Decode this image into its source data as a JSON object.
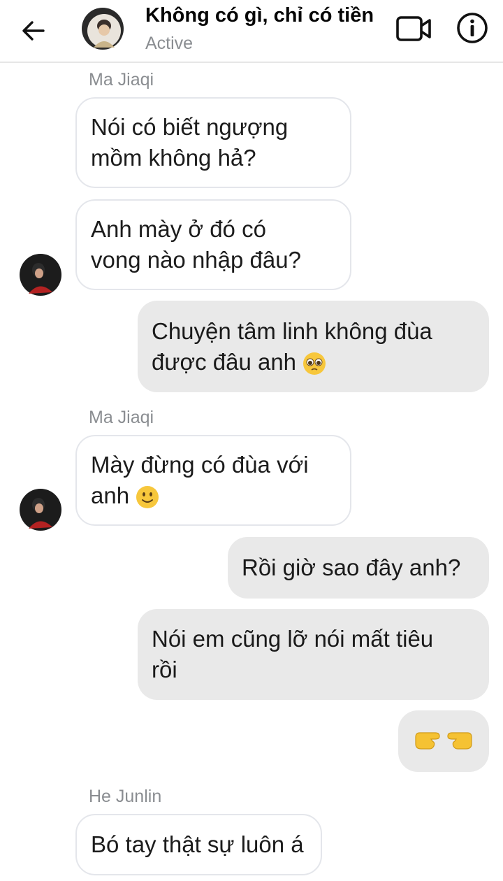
{
  "header": {
    "title": "Không có gì, chỉ có tiền",
    "status": "Active",
    "icons": [
      "back-arrow-icon",
      "video-call-icon",
      "info-icon"
    ]
  },
  "messages": [
    {
      "sender": "Ma Jiaqi"
    },
    {
      "text_1": "Nói có biết ngượng",
      "text_2": "mồm không hả?"
    },
    {
      "text_1": "Anh mày ở đó có",
      "text_2": "vong nào nhập đâu?"
    },
    {
      "text_1": "Chuyện tâm linh không đùa",
      "text_2": "được đâu anh",
      "emoji": "pleading-face-emoji"
    },
    {
      "sender": "Ma Jiaqi"
    },
    {
      "text_1": "Mày đừng có đùa với",
      "text_2": "anh",
      "emoji": "slightly-smiling-face-emoji"
    },
    {
      "text_1": "Rồi giờ sao đây anh?"
    },
    {
      "text_1": "Nói em cũng lỡ nói mất tiêu",
      "text_2": "rồi"
    },
    {
      "emoji": "pointing-hands-emoji"
    },
    {
      "sender": "He Junlin"
    },
    {
      "text_1": "Bó tay thật sự luôn á"
    }
  ]
}
